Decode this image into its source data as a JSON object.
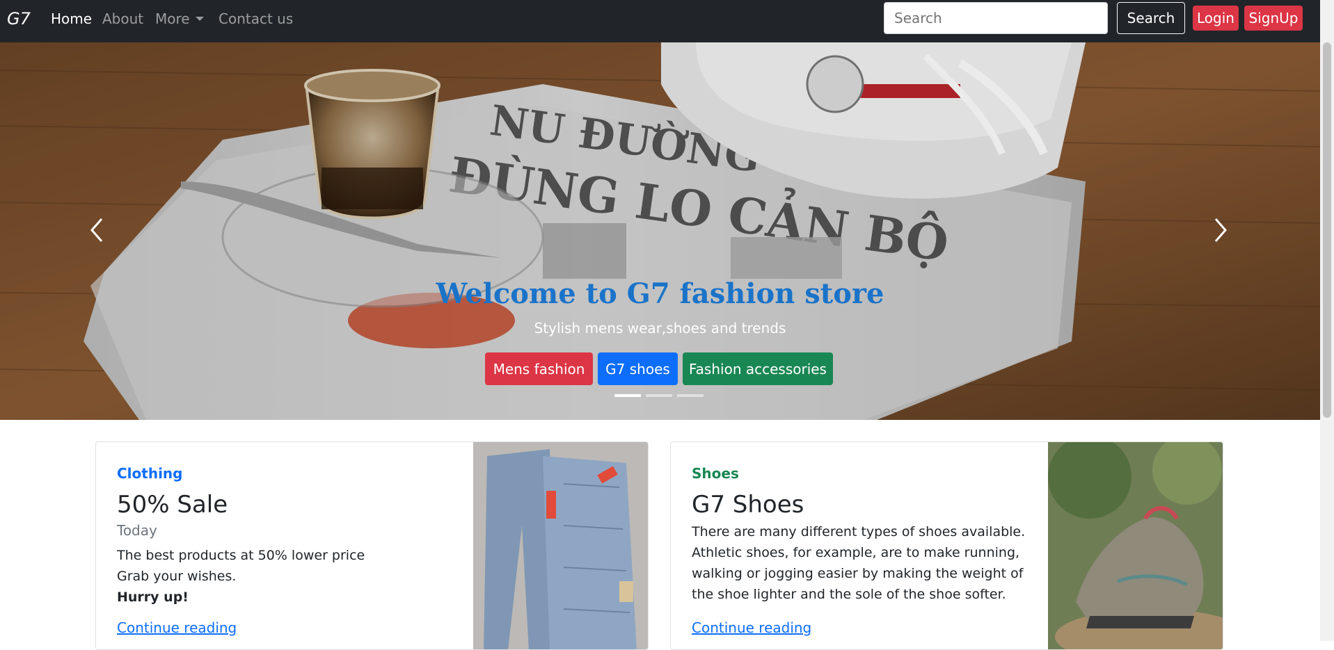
{
  "navbar": {
    "brand": "G7",
    "links": [
      "Home",
      "About",
      "More",
      "Contact us"
    ],
    "search_placeholder": "Search",
    "search_button": "Search",
    "login": "Login",
    "signup": "SignUp"
  },
  "hero": {
    "title": "Welcome to G7 fashion store",
    "subtitle": "Stylish mens wear,shoes and trends",
    "buttons": [
      "Mens fashion",
      "G7 shoes",
      "Fashion accessories"
    ],
    "slides": 3,
    "active_slide": 1,
    "title_color": "#1a73c9"
  },
  "cards": [
    {
      "category": "Clothing",
      "category_color": "#0d6efd",
      "title": "50% Sale",
      "date": "Today",
      "lines": [
        "The best products at 50% lower price",
        "Grab your wishes."
      ],
      "emphasis": "Hurry up!",
      "link": "Continue reading"
    },
    {
      "category": "Shoes",
      "category_color": "#198754",
      "title": "G7 Shoes",
      "lines": [
        "There are many different types of shoes available.",
        "Athletic shoes, for example, are to make running,",
        "walking or jogging easier by making the weight of",
        "the shoe lighter and the sole of the shoe softer."
      ],
      "link": "Continue reading"
    }
  ],
  "colors": {
    "navbar": "#212529",
    "danger": "#dc3545",
    "primary": "#0d6efd",
    "success": "#198754"
  }
}
